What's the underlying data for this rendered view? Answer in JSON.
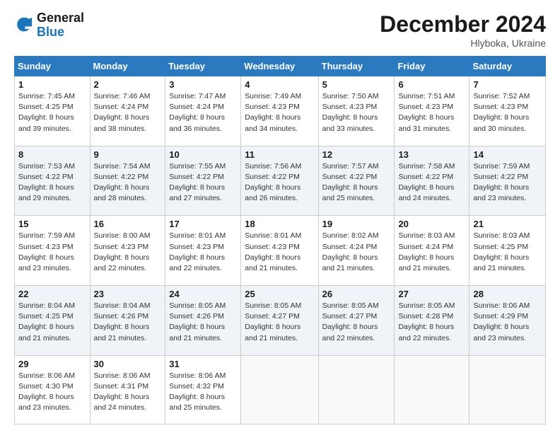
{
  "logo": {
    "line1": "General",
    "line2": "Blue"
  },
  "title": "December 2024",
  "subtitle": "Hlyboka, Ukraine",
  "days_of_week": [
    "Sunday",
    "Monday",
    "Tuesday",
    "Wednesday",
    "Thursday",
    "Friday",
    "Saturday"
  ],
  "weeks": [
    [
      {
        "day": 1,
        "sunrise": "7:45 AM",
        "sunset": "4:25 PM",
        "daylight": "8 hours and 39 minutes."
      },
      {
        "day": 2,
        "sunrise": "7:46 AM",
        "sunset": "4:24 PM",
        "daylight": "8 hours and 38 minutes."
      },
      {
        "day": 3,
        "sunrise": "7:47 AM",
        "sunset": "4:24 PM",
        "daylight": "8 hours and 36 minutes."
      },
      {
        "day": 4,
        "sunrise": "7:49 AM",
        "sunset": "4:23 PM",
        "daylight": "8 hours and 34 minutes."
      },
      {
        "day": 5,
        "sunrise": "7:50 AM",
        "sunset": "4:23 PM",
        "daylight": "8 hours and 33 minutes."
      },
      {
        "day": 6,
        "sunrise": "7:51 AM",
        "sunset": "4:23 PM",
        "daylight": "8 hours and 31 minutes."
      },
      {
        "day": 7,
        "sunrise": "7:52 AM",
        "sunset": "4:23 PM",
        "daylight": "8 hours and 30 minutes."
      }
    ],
    [
      {
        "day": 8,
        "sunrise": "7:53 AM",
        "sunset": "4:22 PM",
        "daylight": "8 hours and 29 minutes."
      },
      {
        "day": 9,
        "sunrise": "7:54 AM",
        "sunset": "4:22 PM",
        "daylight": "8 hours and 28 minutes."
      },
      {
        "day": 10,
        "sunrise": "7:55 AM",
        "sunset": "4:22 PM",
        "daylight": "8 hours and 27 minutes."
      },
      {
        "day": 11,
        "sunrise": "7:56 AM",
        "sunset": "4:22 PM",
        "daylight": "8 hours and 26 minutes."
      },
      {
        "day": 12,
        "sunrise": "7:57 AM",
        "sunset": "4:22 PM",
        "daylight": "8 hours and 25 minutes."
      },
      {
        "day": 13,
        "sunrise": "7:58 AM",
        "sunset": "4:22 PM",
        "daylight": "8 hours and 24 minutes."
      },
      {
        "day": 14,
        "sunrise": "7:59 AM",
        "sunset": "4:22 PM",
        "daylight": "8 hours and 23 minutes."
      }
    ],
    [
      {
        "day": 15,
        "sunrise": "7:59 AM",
        "sunset": "4:23 PM",
        "daylight": "8 hours and 23 minutes."
      },
      {
        "day": 16,
        "sunrise": "8:00 AM",
        "sunset": "4:23 PM",
        "daylight": "8 hours and 22 minutes."
      },
      {
        "day": 17,
        "sunrise": "8:01 AM",
        "sunset": "4:23 PM",
        "daylight": "8 hours and 22 minutes."
      },
      {
        "day": 18,
        "sunrise": "8:01 AM",
        "sunset": "4:23 PM",
        "daylight": "8 hours and 21 minutes."
      },
      {
        "day": 19,
        "sunrise": "8:02 AM",
        "sunset": "4:24 PM",
        "daylight": "8 hours and 21 minutes."
      },
      {
        "day": 20,
        "sunrise": "8:03 AM",
        "sunset": "4:24 PM",
        "daylight": "8 hours and 21 minutes."
      },
      {
        "day": 21,
        "sunrise": "8:03 AM",
        "sunset": "4:25 PM",
        "daylight": "8 hours and 21 minutes."
      }
    ],
    [
      {
        "day": 22,
        "sunrise": "8:04 AM",
        "sunset": "4:25 PM",
        "daylight": "8 hours and 21 minutes."
      },
      {
        "day": 23,
        "sunrise": "8:04 AM",
        "sunset": "4:26 PM",
        "daylight": "8 hours and 21 minutes."
      },
      {
        "day": 24,
        "sunrise": "8:05 AM",
        "sunset": "4:26 PM",
        "daylight": "8 hours and 21 minutes."
      },
      {
        "day": 25,
        "sunrise": "8:05 AM",
        "sunset": "4:27 PM",
        "daylight": "8 hours and 21 minutes."
      },
      {
        "day": 26,
        "sunrise": "8:05 AM",
        "sunset": "4:27 PM",
        "daylight": "8 hours and 22 minutes."
      },
      {
        "day": 27,
        "sunrise": "8:05 AM",
        "sunset": "4:28 PM",
        "daylight": "8 hours and 22 minutes."
      },
      {
        "day": 28,
        "sunrise": "8:06 AM",
        "sunset": "4:29 PM",
        "daylight": "8 hours and 23 minutes."
      }
    ],
    [
      {
        "day": 29,
        "sunrise": "8:06 AM",
        "sunset": "4:30 PM",
        "daylight": "8 hours and 23 minutes."
      },
      {
        "day": 30,
        "sunrise": "8:06 AM",
        "sunset": "4:31 PM",
        "daylight": "8 hours and 24 minutes."
      },
      {
        "day": 31,
        "sunrise": "8:06 AM",
        "sunset": "4:32 PM",
        "daylight": "8 hours and 25 minutes."
      },
      null,
      null,
      null,
      null
    ]
  ]
}
